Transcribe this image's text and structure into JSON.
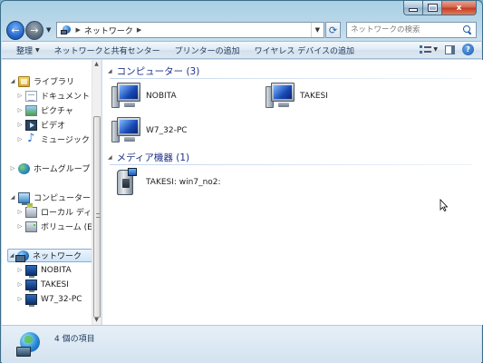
{
  "window": {
    "caption_buttons": {
      "minimize": "",
      "maximize": "",
      "close": "x"
    }
  },
  "address_bar": {
    "back_icon": "back-arrow-icon",
    "forward_icon": "forward-arrow-icon",
    "crumbs": [
      "ネットワーク"
    ],
    "search_placeholder": "ネットワークの検索"
  },
  "command_bar": {
    "items": [
      "整理",
      "ネットワークと共有センター",
      "プリンターの追加",
      "ワイヤレス デバイスの追加"
    ]
  },
  "nav_pane": {
    "items": [
      {
        "label": "ライブラリ",
        "icon": "library-icon",
        "level": 0,
        "expanded": true
      },
      {
        "label": "ドキュメント",
        "icon": "documents-icon",
        "level": 1
      },
      {
        "label": "ピクチャ",
        "icon": "pictures-icon",
        "level": 1
      },
      {
        "label": "ビデオ",
        "icon": "videos-icon",
        "level": 1
      },
      {
        "label": "ミュージック",
        "icon": "music-icon",
        "level": 1
      },
      {
        "label": "ホームグループ",
        "icon": "homegroup-icon",
        "level": 0
      },
      {
        "label": "コンピューター",
        "icon": "computer-icon",
        "level": 0,
        "expanded": true
      },
      {
        "label": "ローカル ディス",
        "icon": "local-disk-icon",
        "level": 1
      },
      {
        "label": "ボリューム (E:)",
        "icon": "volume-icon",
        "level": 1
      },
      {
        "label": "ネットワーク",
        "icon": "network-icon",
        "level": 0,
        "expanded": true,
        "selected": true
      },
      {
        "label": "NOBITA",
        "icon": "network-pc-icon",
        "level": 1
      },
      {
        "label": "TAKESI",
        "icon": "network-pc-icon",
        "level": 1
      },
      {
        "label": "W7_32-PC",
        "icon": "network-pc-icon",
        "level": 1
      }
    ]
  },
  "content": {
    "groups": [
      {
        "header": "コンピューター (3)",
        "items": [
          "NOBITA",
          "TAKESI",
          "W7_32-PC"
        ]
      },
      {
        "header": "メディア機器 (1)",
        "items": [
          "TAKESI: win7_no2:"
        ]
      }
    ]
  },
  "status_bar": {
    "text": "4 個の項目"
  }
}
